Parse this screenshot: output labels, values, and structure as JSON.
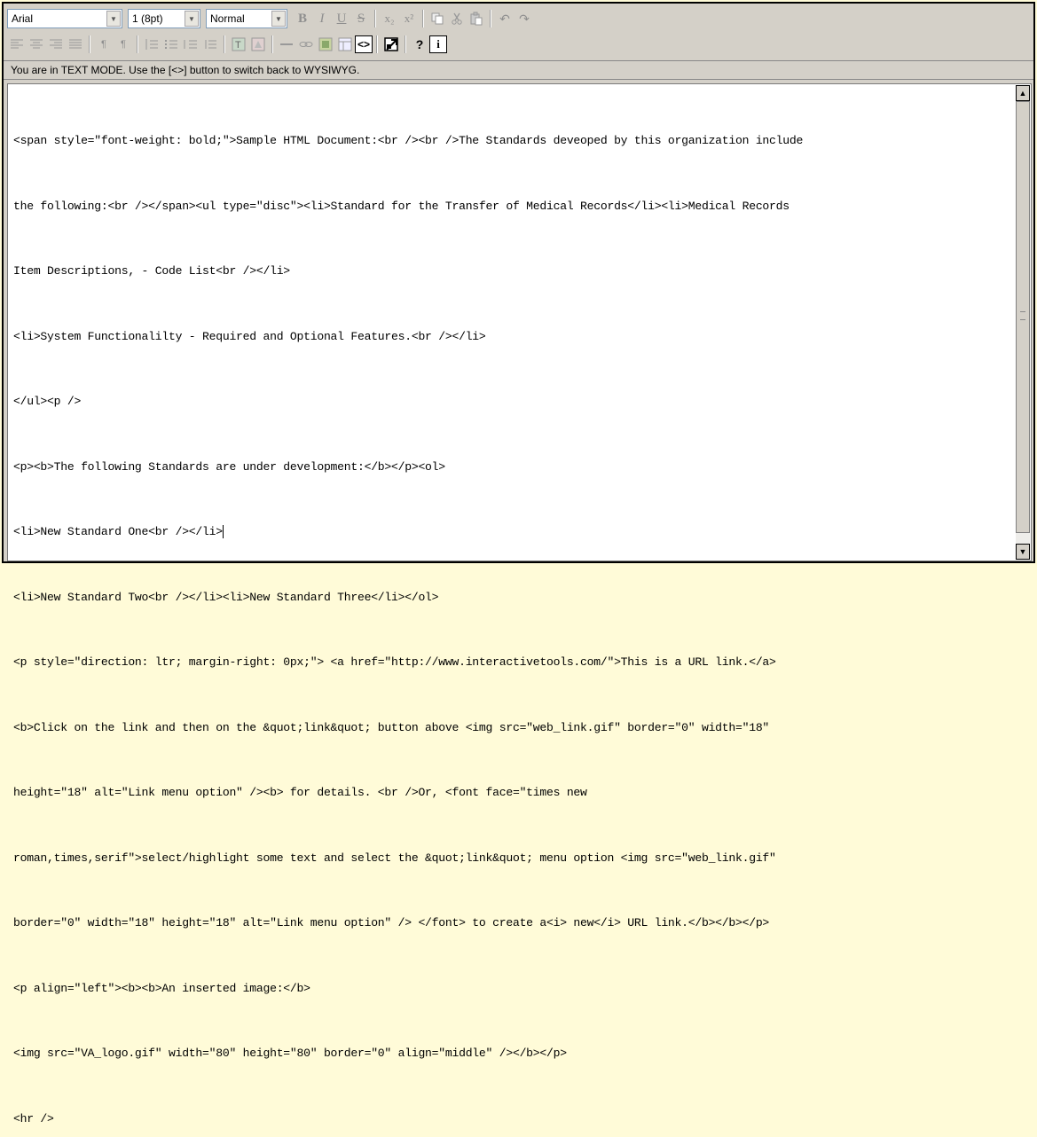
{
  "toolbar": {
    "font_family": "Arial",
    "font_size": "1 (8pt)",
    "paragraph_style": "Normal",
    "buttons_row1": [
      {
        "name": "bold-icon",
        "glyph": "B"
      },
      {
        "name": "italic-icon",
        "glyph": "I"
      },
      {
        "name": "underline-icon",
        "glyph": "U"
      },
      {
        "name": "strikethrough-icon",
        "glyph": "S"
      },
      {
        "name": "subscript-icon",
        "glyph": "x₂"
      },
      {
        "name": "superscript-icon",
        "glyph": "x²"
      },
      {
        "name": "copy-icon",
        "glyph": ""
      },
      {
        "name": "cut-icon",
        "glyph": ""
      },
      {
        "name": "paste-icon",
        "glyph": ""
      },
      {
        "name": "undo-icon",
        "glyph": "↶"
      },
      {
        "name": "redo-icon",
        "glyph": "↷"
      }
    ],
    "buttons_row2": [
      "align-left-icon",
      "align-center-icon",
      "align-right-icon",
      "justify-icon",
      "ltr-icon",
      "rtl-icon",
      "ordered-list-icon",
      "unordered-list-icon",
      "outdent-icon",
      "indent-icon",
      "text-color-icon",
      "highlight-color-icon",
      "horizontal-rule-icon",
      "link-icon",
      "image-icon",
      "table-icon",
      "toggle-html-icon",
      "fullscreen-icon",
      "help-icon",
      "about-icon"
    ],
    "toggle_html_glyph": "<>",
    "help_glyph": "?",
    "about_glyph": "i"
  },
  "message": "You are in TEXT MODE. Use the [<>] button to switch back to WYSIWYG.",
  "editor": {
    "lines": [
      "<span style=\"font-weight: bold;\">Sample HTML Document:<br /><br />The Standards deveoped by this organization include",
      "the following:<br /></span><ul type=\"disc\"><li>Standard for the Transfer of Medical Records</li><li>Medical Records",
      "Item Descriptions, - Code List<br /></li>",
      "<li>System Functionalilty - Required and Optional Features.<br /></li>",
      "</ul><p />",
      "<p><b>The following Standards are under development:</b></p><ol>",
      "<li>New Standard One<br /></li>",
      "<li>New Standard Two<br /></li><li>New Standard Three</li></ol>",
      "<p style=\"direction: ltr; margin-right: 0px;\"> <a href=\"http://www.interactivetools.com/\">This is a URL link.</a>",
      "<b>Click on the link and then on the &quot;link&quot; button above <img src=\"web_link.gif\" border=\"0\" width=\"18\"",
      "height=\"18\" alt=\"Link menu option\" /><b> for details. <br />Or, <font face=\"times new",
      "roman,times,serif\">select/highlight some text and select the &quot;link&quot; menu option <img src=\"web_link.gif\"",
      "border=\"0\" width=\"18\" height=\"18\" alt=\"Link menu option\" /> </font> to create a<i> new</i> URL link.</b></b></p>",
      "<p align=\"left\"><b><b>An inserted image:</b>",
      "<img src=\"VA_logo.gif\" width=\"80\" height=\"80\" border=\"0\" align=\"middle\" /></b></p>",
      "<hr />"
    ]
  }
}
